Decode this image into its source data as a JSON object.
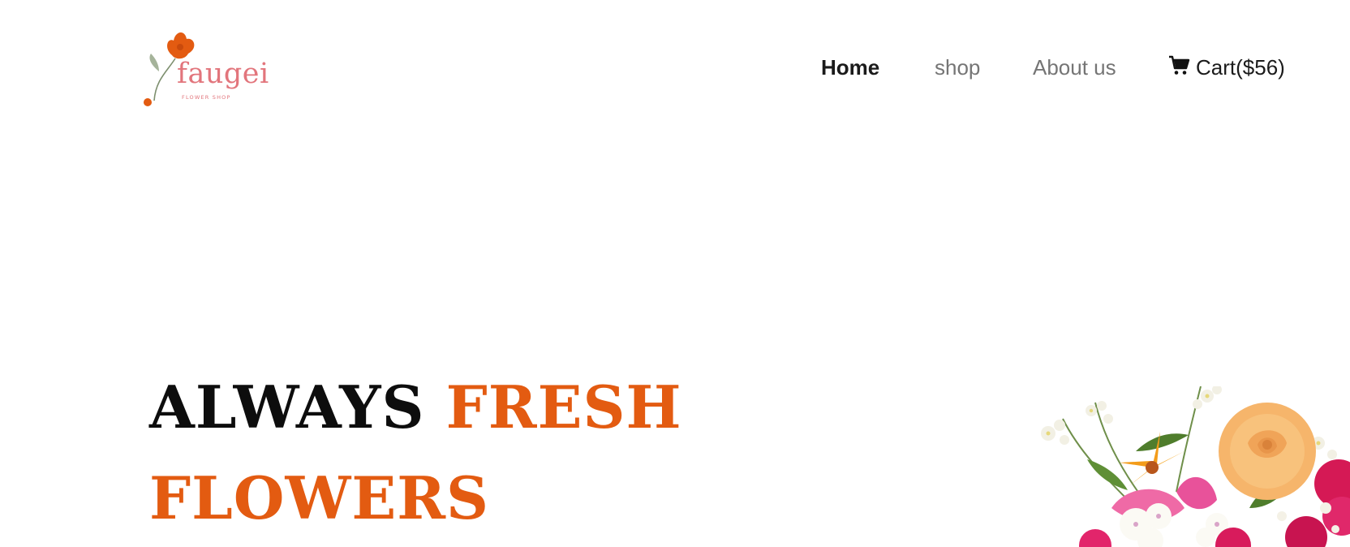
{
  "brand": {
    "logo_name": "faugei",
    "logo_subtitle": "FLOWER SHOP",
    "logo_icon": "flower-logo-icon"
  },
  "nav": {
    "items": [
      {
        "label": "Home",
        "active": true
      },
      {
        "label": "shop",
        "active": false
      },
      {
        "label": "About us",
        "active": false
      }
    ],
    "cart": {
      "icon": "cart-icon",
      "label": "Cart($56)"
    }
  },
  "hero": {
    "title_part1": "ALWAYS",
    "title_part2": "FRESH",
    "title_part3": "FLOWERS",
    "image": "flower-bouquet-image"
  },
  "colors": {
    "accent": "#e35b11",
    "text_dark": "#0d0d0d",
    "nav_inactive": "#757575",
    "logo_pink": "#e2757c",
    "background": "#ffffff"
  }
}
